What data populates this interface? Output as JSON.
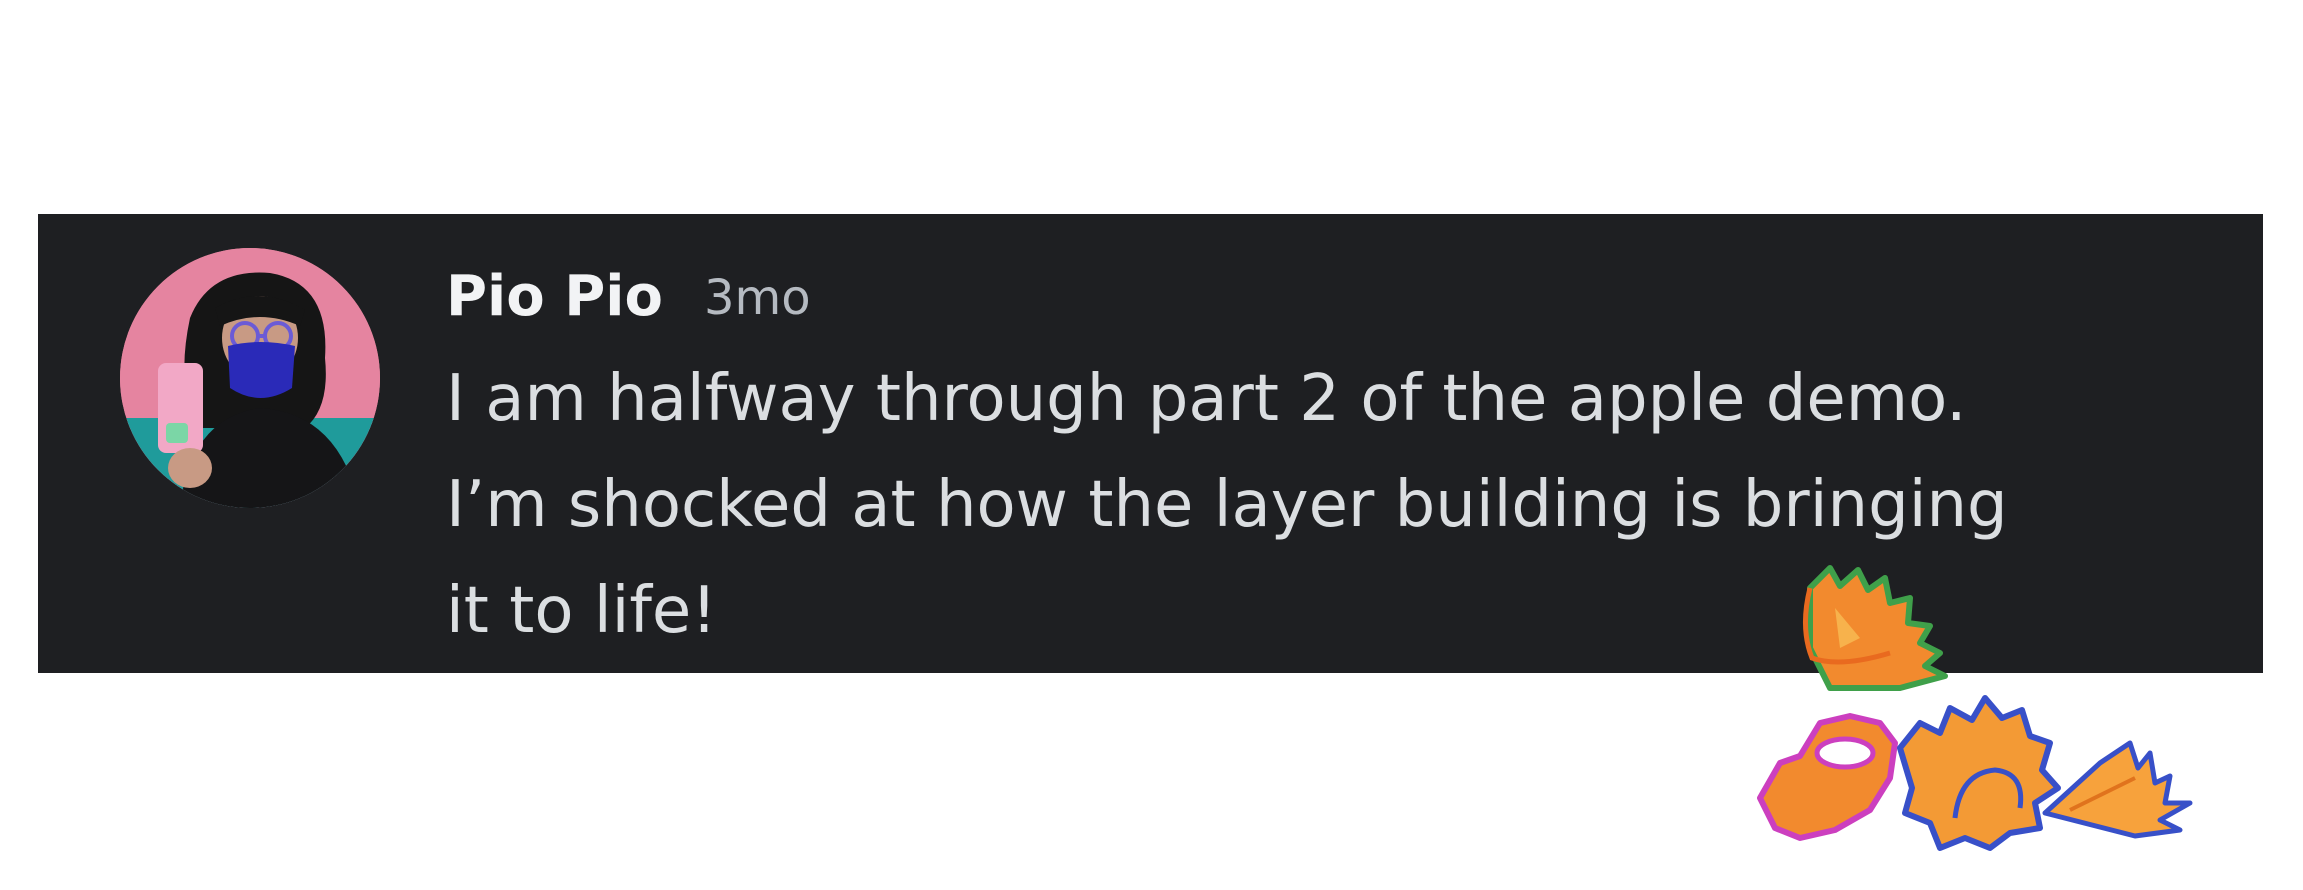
{
  "message": {
    "author": "Pio Pio",
    "timestamp": "3mo",
    "lines": [
      "I am halfway through part 2 of the apple demo.",
      "I’m shocked at how the layer building is bringing",
      "it to life!"
    ]
  },
  "icons": {
    "avatar": "user-avatar-photo",
    "decoration": "pencil-shavings-illustration"
  },
  "colors": {
    "card_background": "#1e1f22",
    "author_text": "#f2f3f5",
    "timestamp_text": "#b5bac1",
    "message_text": "#dbdee1",
    "page_background": "#ffffff"
  }
}
